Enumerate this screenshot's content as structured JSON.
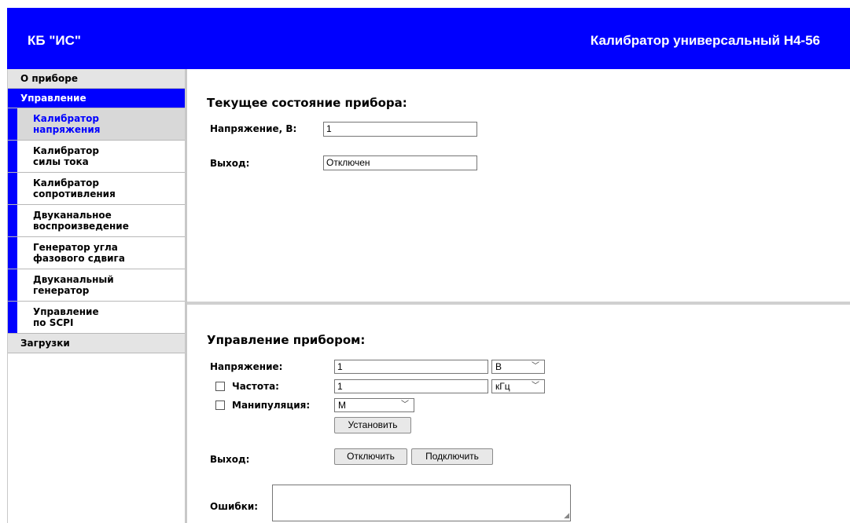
{
  "header": {
    "brand": "КБ \"ИС\"",
    "device_title": "Калибратор универсальный Н4-56",
    "bg_color": "#0000ff"
  },
  "sidebar": {
    "about": "О приборе",
    "control": "Управление",
    "items": [
      {
        "label": "Калибратор\nнапряжения",
        "current": true
      },
      {
        "label": "Калибратор\nсилы тока"
      },
      {
        "label": "Калибратор\nсопротивления"
      },
      {
        "label": "Двуканальное\nвоспроизведение"
      },
      {
        "label": "Генератор угла\nфазового сдвига"
      },
      {
        "label": "Двуканальный\nгенератор"
      },
      {
        "label": "Управление\nпо SCPI"
      }
    ],
    "downloads": "Загрузки"
  },
  "status": {
    "title": "Текущее состояние прибора:",
    "voltage_label": "Напряжение, В:",
    "voltage_value": "1",
    "output_label": "Выход:",
    "output_value": "Отключен"
  },
  "control": {
    "title": "Управление прибором:",
    "voltage_label": "Напряжение:",
    "voltage_value": "1",
    "voltage_unit": "В",
    "frequency_label": "Частота:",
    "frequency_value": "1",
    "frequency_unit": "кГц",
    "frequency_checked": false,
    "modulation_label": "Манипуляция:",
    "modulation_value": "М",
    "modulation_checked": false,
    "set_button": "Установить",
    "output_label": "Выход:",
    "disconnect_button": "Отключить",
    "connect_button": "Подключить",
    "errors_label": "Ошибки:",
    "errors_value": ""
  }
}
